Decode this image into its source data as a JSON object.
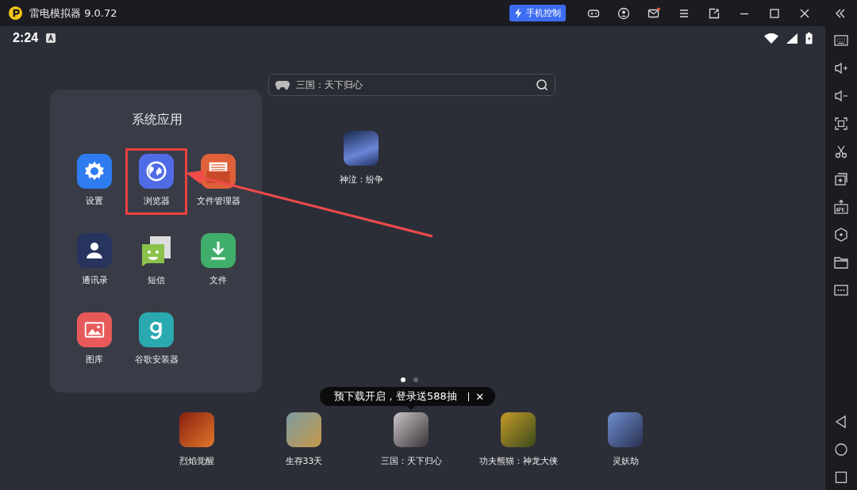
{
  "title_bar": {
    "app_name": "雷电模拟器 9.0.72",
    "control_button": "手机控制",
    "mail_unread": true
  },
  "status_bar": {
    "time": "2:24"
  },
  "search": {
    "placeholder": "三国：天下归心"
  },
  "folder": {
    "title": "系统应用",
    "apps": [
      {
        "label": "设置",
        "kind": "settings",
        "highlighted": false
      },
      {
        "label": "浏览器",
        "kind": "browser",
        "highlighted": true
      },
      {
        "label": "文件管理器",
        "kind": "file-manager",
        "highlighted": false
      },
      {
        "label": "通讯录",
        "kind": "contacts",
        "highlighted": false
      },
      {
        "label": "短信",
        "kind": "messages",
        "highlighted": false
      },
      {
        "label": "文件",
        "kind": "download",
        "highlighted": false
      },
      {
        "label": "图库",
        "kind": "gallery",
        "highlighted": false
      },
      {
        "label": "谷歌安装器",
        "kind": "installer",
        "highlighted": false
      }
    ]
  },
  "desktop_apps": [
    {
      "label": "神泣：纷争"
    }
  ],
  "pages": [
    {
      "selected": true
    },
    {
      "selected": false
    }
  ],
  "promo_tooltip": {
    "text": "预下载开启，登录送588抽",
    "close": "✕"
  },
  "dock": [
    {
      "label": "烈焰觉醒"
    },
    {
      "label": "生存33天"
    },
    {
      "label": "三国：天下归心"
    },
    {
      "label": "功夫熊猫：神龙大侠"
    },
    {
      "label": "灵妖劫"
    }
  ]
}
